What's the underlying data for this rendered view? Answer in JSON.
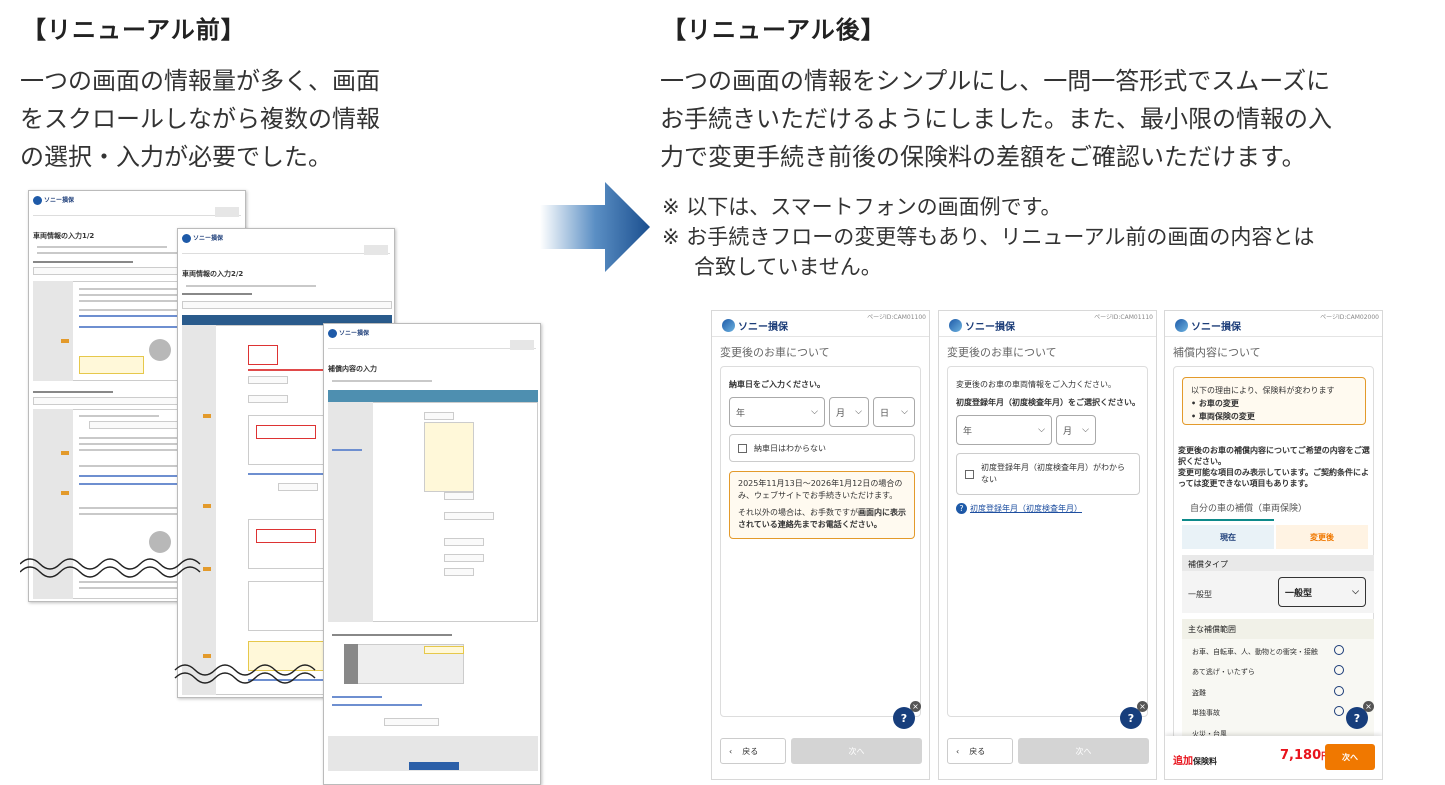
{
  "left": {
    "heading": "【リニューアル前】",
    "desc": [
      "一つの画面の情報量が多く、画面",
      "をスクロールしながら複数の情報",
      "の選択・入力が必要でした。"
    ],
    "pages": {
      "p1_title": "車両情報の入力1/2",
      "p2_title": "車両情報の入力2/2",
      "p3_title": "補償内容の入力",
      "logo": "ソニー損保"
    }
  },
  "right": {
    "heading": "【リニューアル後】",
    "desc": [
      "一つの画面の情報をシンプルにし、一問一答形式でスムーズに",
      "お手続きいただけるようにしました。また、最小限の情報の入",
      "力で変更手続き前後の保険料の差額をご確認いただけます。"
    ],
    "notes": [
      "※ 以下は、スマートフォンの画面例です。",
      "※ お手続きフローの変更等もあり、リニューアル前の画面の内容とは",
      "合致していません。"
    ]
  },
  "phone1": {
    "page_id": "ページID:CAM01100",
    "logo": "ソニー損保",
    "section": "変更後のお車について",
    "question": "納車日をご入力ください。",
    "sel_year": "年",
    "sel_month": "月",
    "sel_day": "日",
    "unknown": "納車日はわからない",
    "info1": "2025年11月13日～2026年1月12日の場合のみ、ウェブサイトでお手続きいただけます。",
    "info2_pre": "それ以外の場合は、お手数ですが",
    "info2_bold": "画面内に表示されている連絡先までお電話ください。",
    "back": "戻る",
    "next": "次へ"
  },
  "phone2": {
    "page_id": "ページID:CAM01110",
    "logo": "ソニー損保",
    "section": "変更後のお車について",
    "intro": "変更後のお車の車両情報をご入力ください。",
    "question": "初度登録年月（初度検査年月）をご選択ください。",
    "sel_year": "年",
    "sel_month": "月",
    "unknown": "初度登録年月（初度検査年月）がわからない",
    "help_link": "初度登録年月（初度検査年月）",
    "back": "戻る",
    "next": "次へ"
  },
  "phone3": {
    "page_id": "ページID:CAM02000",
    "logo": "ソニー損保",
    "section": "補償内容について",
    "reason_title": "以下の理由により、保険料が変わります",
    "reasons": [
      "お車の変更",
      "車両保険の変更"
    ],
    "lead1": "変更後のお車の補償内容についてご希望の内容をご選択ください。",
    "lead2": "変更可能な項目のみ表示しています。ご契約条件によっては変更できない項目もあります。",
    "subsection": "自分の車の補償（車両保険）",
    "tab_current": "現在",
    "tab_after": "変更後",
    "type_label": "補償タイプ",
    "type_current": "一般型",
    "type_select": "一般型",
    "range_label": "主な補償範囲",
    "range_items": [
      "お車、自転車、人、動物との衝突・接触",
      "あて逃げ・いたずら",
      "盗難",
      "単独事故",
      "火災・台風"
    ],
    "add_label": "追加",
    "premium_label": "保険料",
    "premium_value": "7,180",
    "premium_unit": "円",
    "next": "次へ"
  },
  "colors": {
    "accent": "#1b3c78",
    "orange": "#f07800",
    "red": "#e8131c"
  }
}
